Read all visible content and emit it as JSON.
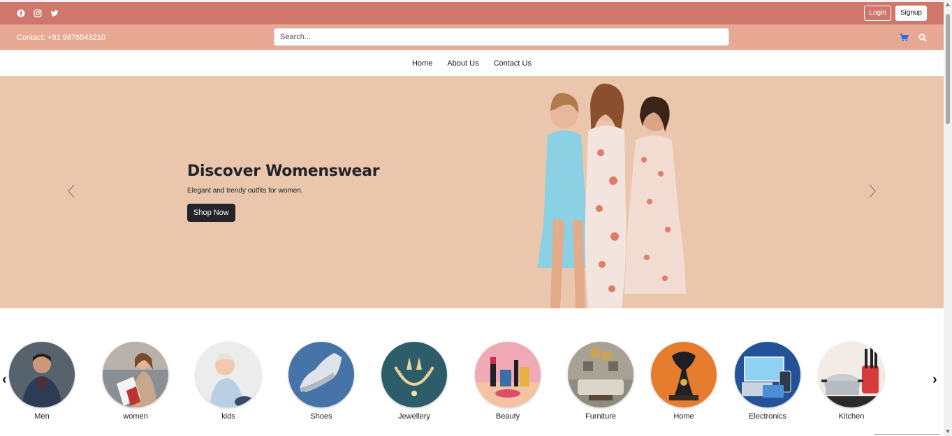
{
  "topbar": {
    "social_icons": [
      "facebook-icon",
      "instagram-icon",
      "twitter-icon"
    ],
    "login_label": "Login",
    "signup_label": "Signup",
    "bg_color": "#cf776c"
  },
  "contactbar": {
    "contact_text": "Contact: +91 9876543210",
    "search_placeholder": "Search...",
    "icons": [
      "cart-icon",
      "search-icon"
    ],
    "bg_color": "#e8a994",
    "cart_color": "#1a73e8"
  },
  "nav": {
    "items": [
      {
        "label": "Home"
      },
      {
        "label": "About Us"
      },
      {
        "label": "Contact Us"
      }
    ]
  },
  "hero": {
    "title": "Discover Womenswear",
    "subtitle": "Elegant and trendy outfits for women.",
    "button_label": "Shop Now",
    "bg_color": "#eac6ac",
    "icons": [
      "chevron-left-icon",
      "chevron-right-icon"
    ]
  },
  "categories": {
    "prev_glyph": "‹",
    "next_glyph": "›",
    "items": [
      {
        "label": "Men"
      },
      {
        "label": "women"
      },
      {
        "label": "kids"
      },
      {
        "label": "Shoes"
      },
      {
        "label": "Jewellery"
      },
      {
        "label": "Beauty"
      },
      {
        "label": "Furniture"
      },
      {
        "label": "Home"
      },
      {
        "label": "Electronics"
      },
      {
        "label": "Kitchen"
      }
    ]
  }
}
